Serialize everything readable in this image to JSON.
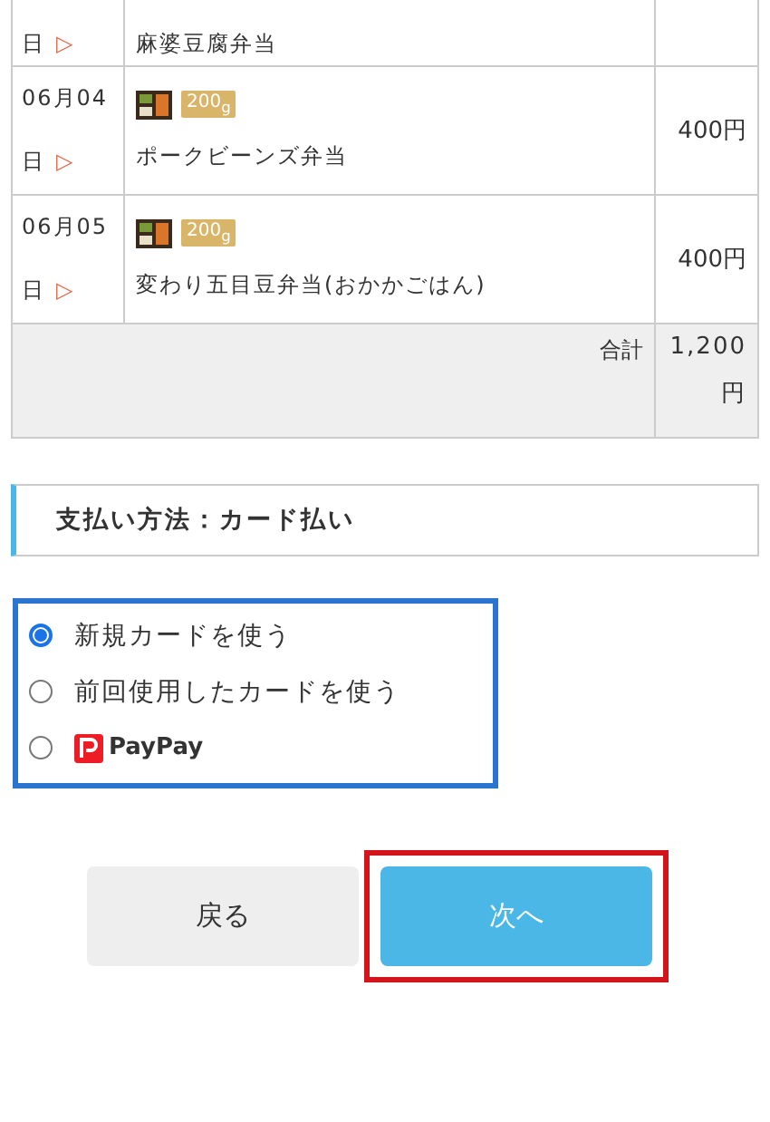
{
  "order_table": {
    "rows": [
      {
        "day": "日",
        "arrow": "▷",
        "name": "麻婆豆腐弁当"
      },
      {
        "date": "06月04",
        "day": "日",
        "arrow": "▷",
        "name": "ポークビーンズ弁当",
        "weight": "200$_{g}$",
        "price": "400円"
      },
      {
        "date": "06月05",
        "day": "日",
        "arrow": "▷",
        "name": "変わり五目豆弁当(おかかごはん)",
        "weight": "200$_{g}$",
        "price": "400円"
      }
    ],
    "total_label": "合計",
    "total": "1,200円"
  },
  "payment": {
    "heading": "支払い方法：カード払い",
    "options": [
      {
        "kind": "text",
        "label": "新規カードを使う",
        "selected": true
      },
      {
        "kind": "text",
        "label": "前回使用したカードを使う",
        "selected": false
      },
      {
        "kind": "paypay",
        "label": "PayPay",
        "selected": false
      }
    ]
  },
  "buttons": [
    {
      "label": "戻る",
      "kind": "secondary"
    },
    {
      "label": "次へ",
      "kind": "primary"
    }
  ]
}
